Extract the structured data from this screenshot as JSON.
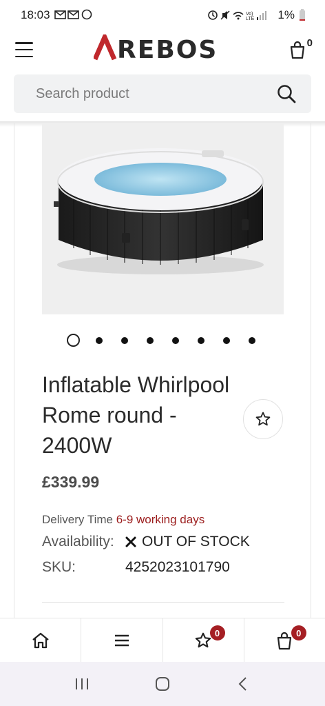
{
  "status_bar": {
    "time": "18:03",
    "left_icons": "gmail-icon gmail-icon whatsapp-icon",
    "battery": "1%"
  },
  "header": {
    "logo": "AREBOS",
    "cart_count": "0"
  },
  "search": {
    "placeholder": "Search product"
  },
  "product": {
    "title": "Inflatable Whirlpool Rome round - 2400W",
    "price": "£339.99",
    "delivery_label": "Delivery Time",
    "delivery_value": "6-9 working days",
    "availability_label": "Availability:",
    "availability_value": "OUT OF STOCK",
    "sku_label": "SKU:",
    "sku_value": "4252023101790",
    "image_count": 8,
    "active_image": 1
  },
  "bottom_nav": {
    "wishlist_count": "0",
    "cart_count": "0"
  },
  "colors": {
    "accent": "#a51f24",
    "logo_red": "#c0282c",
    "delivery_red": "#9b1c1c"
  }
}
